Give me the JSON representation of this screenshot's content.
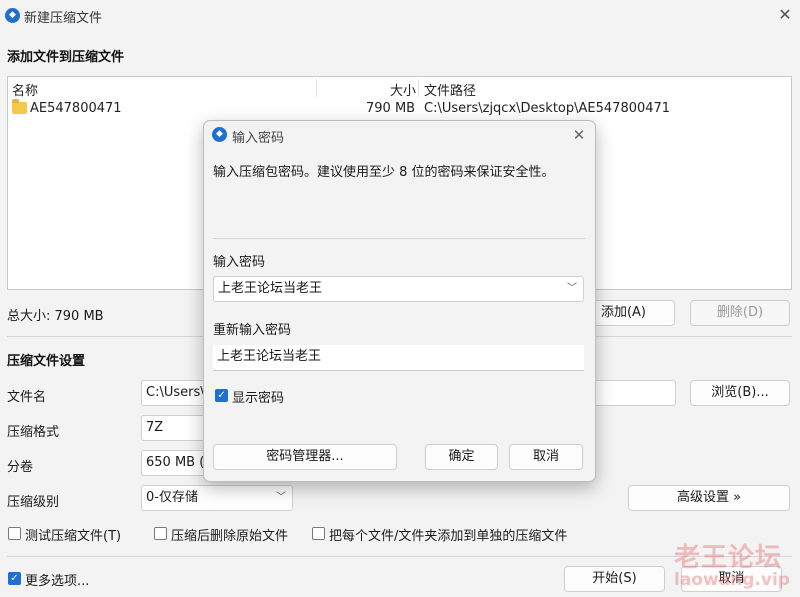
{
  "window": {
    "title": "新建压缩文件",
    "close": "✕"
  },
  "add_section": {
    "title": "添加文件到压缩文件",
    "columns": [
      "名称",
      "大小",
      "文件路径"
    ],
    "rows": [
      {
        "name": "AE547800471",
        "size": "790 MB",
        "path": "C:\\Users\\zjqcx\\Desktop\\AE547800471"
      }
    ],
    "total_size": "总大小: 790 MB",
    "add_button": "添加(A)",
    "delete_button": "删除(D)"
  },
  "settings": {
    "title": "压缩文件设置",
    "filename_label": "文件名",
    "filename_value": "C:\\Users\\",
    "browse_button": "浏览(B)...",
    "format_label": "压缩格式",
    "format_value": "7Z",
    "volume_label": "分卷",
    "volume_value": "650 MB (",
    "level_label": "压缩级别",
    "level_value": "0-仅存储",
    "advanced_button": "高级设置 »",
    "check_test": "测试压缩文件(T)",
    "check_delete": "压缩后删除原始文件",
    "check_each": "把每个文件/文件夹添加到单独的压缩文件",
    "more_options": "更多选项...",
    "start_button": "开始(S)",
    "cancel_button": "取消"
  },
  "dialog": {
    "title": "输入密码",
    "close": "✕",
    "info": "输入压缩包密码。建议使用至少 8 位的密码来保证安全性。",
    "password_label": "输入密码",
    "password_value": "上老王论坛当老王",
    "confirm_label": "重新输入密码",
    "confirm_value": "上老王论坛当老王",
    "show_password": "显示密码",
    "manager_button": "密码管理器...",
    "ok_button": "确定",
    "cancel_button": "取消"
  },
  "watermark": {
    "line1": "老王论坛",
    "line2": "laowang.vip"
  },
  "colors": {
    "accent": "#1f6fd1",
    "folder": "#f4c84a"
  }
}
